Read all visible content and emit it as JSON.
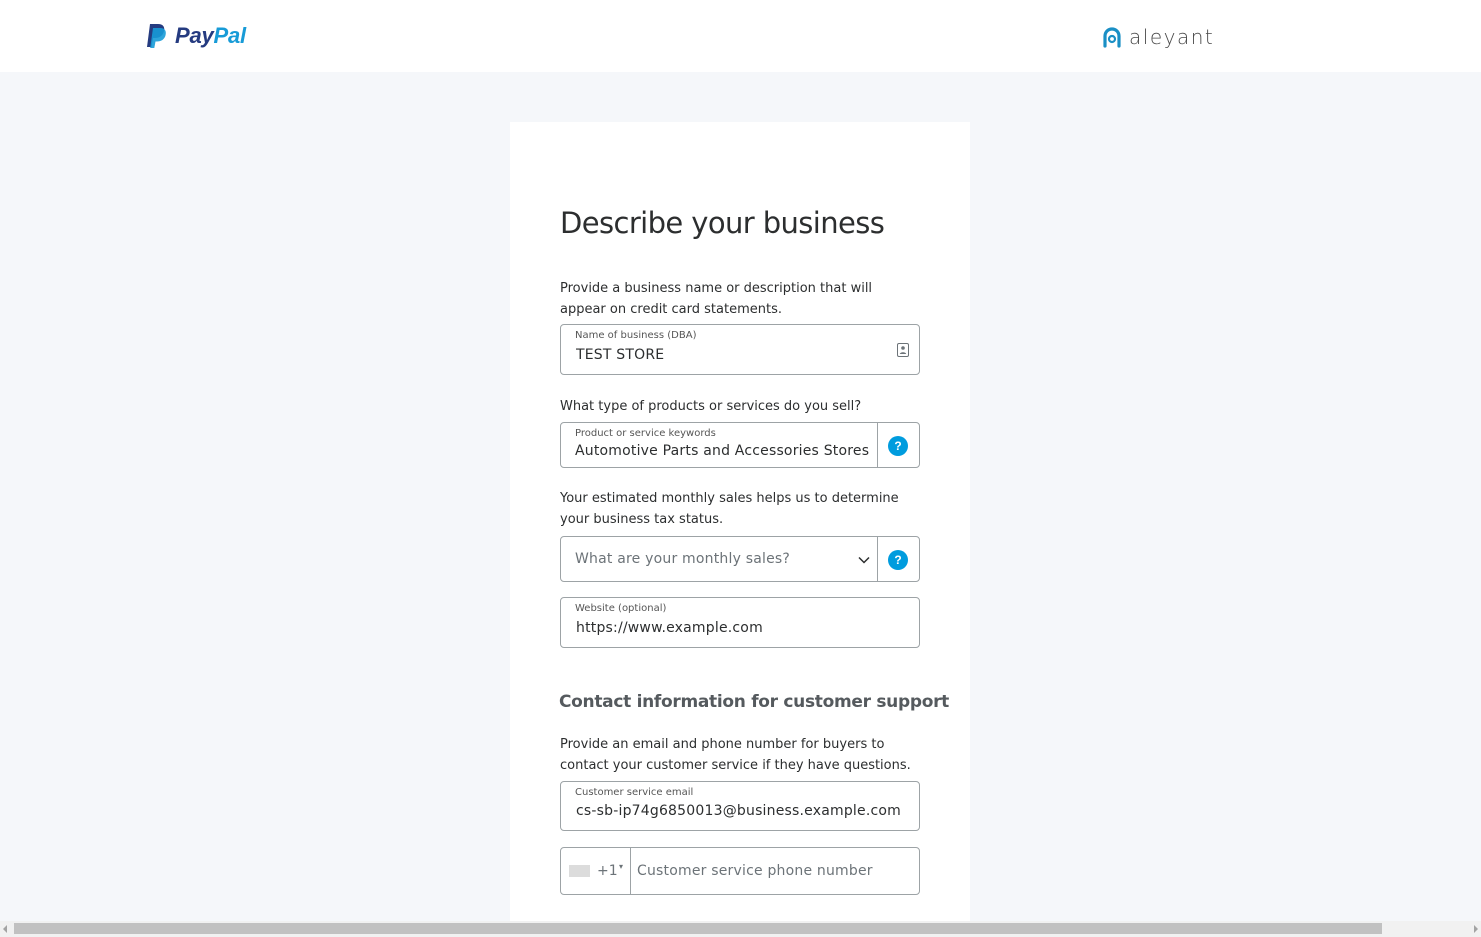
{
  "header": {
    "paypal_logo": {
      "pay": "Pay",
      "pal": "Pal",
      "brand_colors": [
        "#253b80",
        "#179bd7"
      ]
    },
    "partner_logo": {
      "text": "aleyant",
      "accent": "#1a8fc5"
    }
  },
  "form": {
    "title": "Describe your business",
    "business_name": {
      "description": "Provide a business name or description that will appear on credit card statements.",
      "label": "Name of business (DBA)",
      "value": "TEST STORE",
      "icon": "contact-card-icon"
    },
    "products": {
      "description": "What type of products or services do you sell?",
      "label": "Product or service keywords",
      "value": "Automotive Parts and Accessories Stores",
      "help": "?"
    },
    "monthly_sales": {
      "description": "Your estimated monthly sales helps us to determine your business tax status.",
      "placeholder": "What are your monthly sales?",
      "help": "?"
    },
    "website": {
      "label": "Website (optional)",
      "value": "https://www.example.com"
    }
  },
  "support": {
    "heading": "Contact information for customer support",
    "description": "Provide an email and phone number for buyers to contact your customer service if they have questions.",
    "email": {
      "label": "Customer service email",
      "value": "cs-sb-ip74g6850013@business.example.com"
    },
    "phone": {
      "country_code": "+1",
      "caret": "▾",
      "placeholder": "Customer service phone number"
    }
  },
  "colors": {
    "help_button": "#009cde",
    "page_background": "#f5f7fa",
    "field_border": "#9da3a6"
  }
}
